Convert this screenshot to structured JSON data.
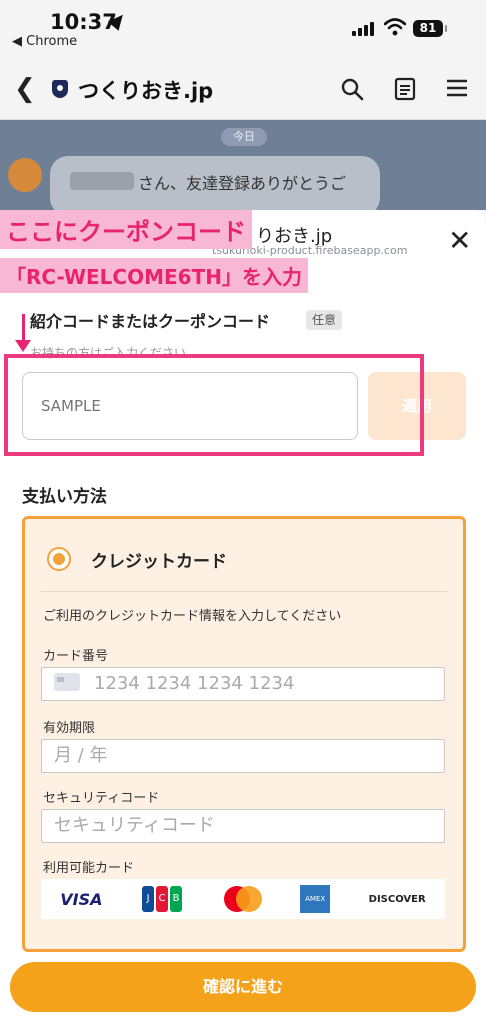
{
  "status_bar": {
    "time": "10:37",
    "back_app": "◀ Chrome",
    "battery": "81"
  },
  "navbar": {
    "back_icon": "chevron-left-icon",
    "site_title": "つくりおき.jp",
    "icons": [
      "search-icon",
      "reader-icon",
      "menu-icon"
    ]
  },
  "chat": {
    "today": "今日",
    "message": "さん、友達登録ありがとうご"
  },
  "sheet": {
    "title": "くりおき.jp",
    "url": "tsukurioki-product.firebaseapp.com",
    "close_icon": "close-icon"
  },
  "annotation": {
    "line1": "ここにクーポンコード",
    "line2": "「RC-WELCOME6TH」を入力",
    "color": "#e8246f"
  },
  "coupon": {
    "label": "紹介コードまたはクーポンコード",
    "optional": "任意",
    "hint": "お持ちの方はご入力ください",
    "placeholder": "SAMPLE",
    "apply": "適用"
  },
  "payment": {
    "title": "支払い方法",
    "method": "クレジットカード",
    "note": "ご利用のクレジットカード情報を入力してください",
    "card_number_label": "カード番号",
    "card_number_placeholder": "1234 1234 1234 1234",
    "expiry_label": "有効期限",
    "expiry_placeholder": "月 / 年",
    "cvc_label": "セキュリティコード",
    "cvc_placeholder": "セキュリティコード",
    "brands_label": "利用可能カード",
    "brands": [
      "VISA",
      "JCB",
      "Mastercard",
      "AMERICAN EXPRESS",
      "DISCOVER"
    ]
  },
  "confirm": "確認に進む",
  "colors": {
    "accent": "#f5a21b",
    "annotation": "#ec3a80"
  }
}
